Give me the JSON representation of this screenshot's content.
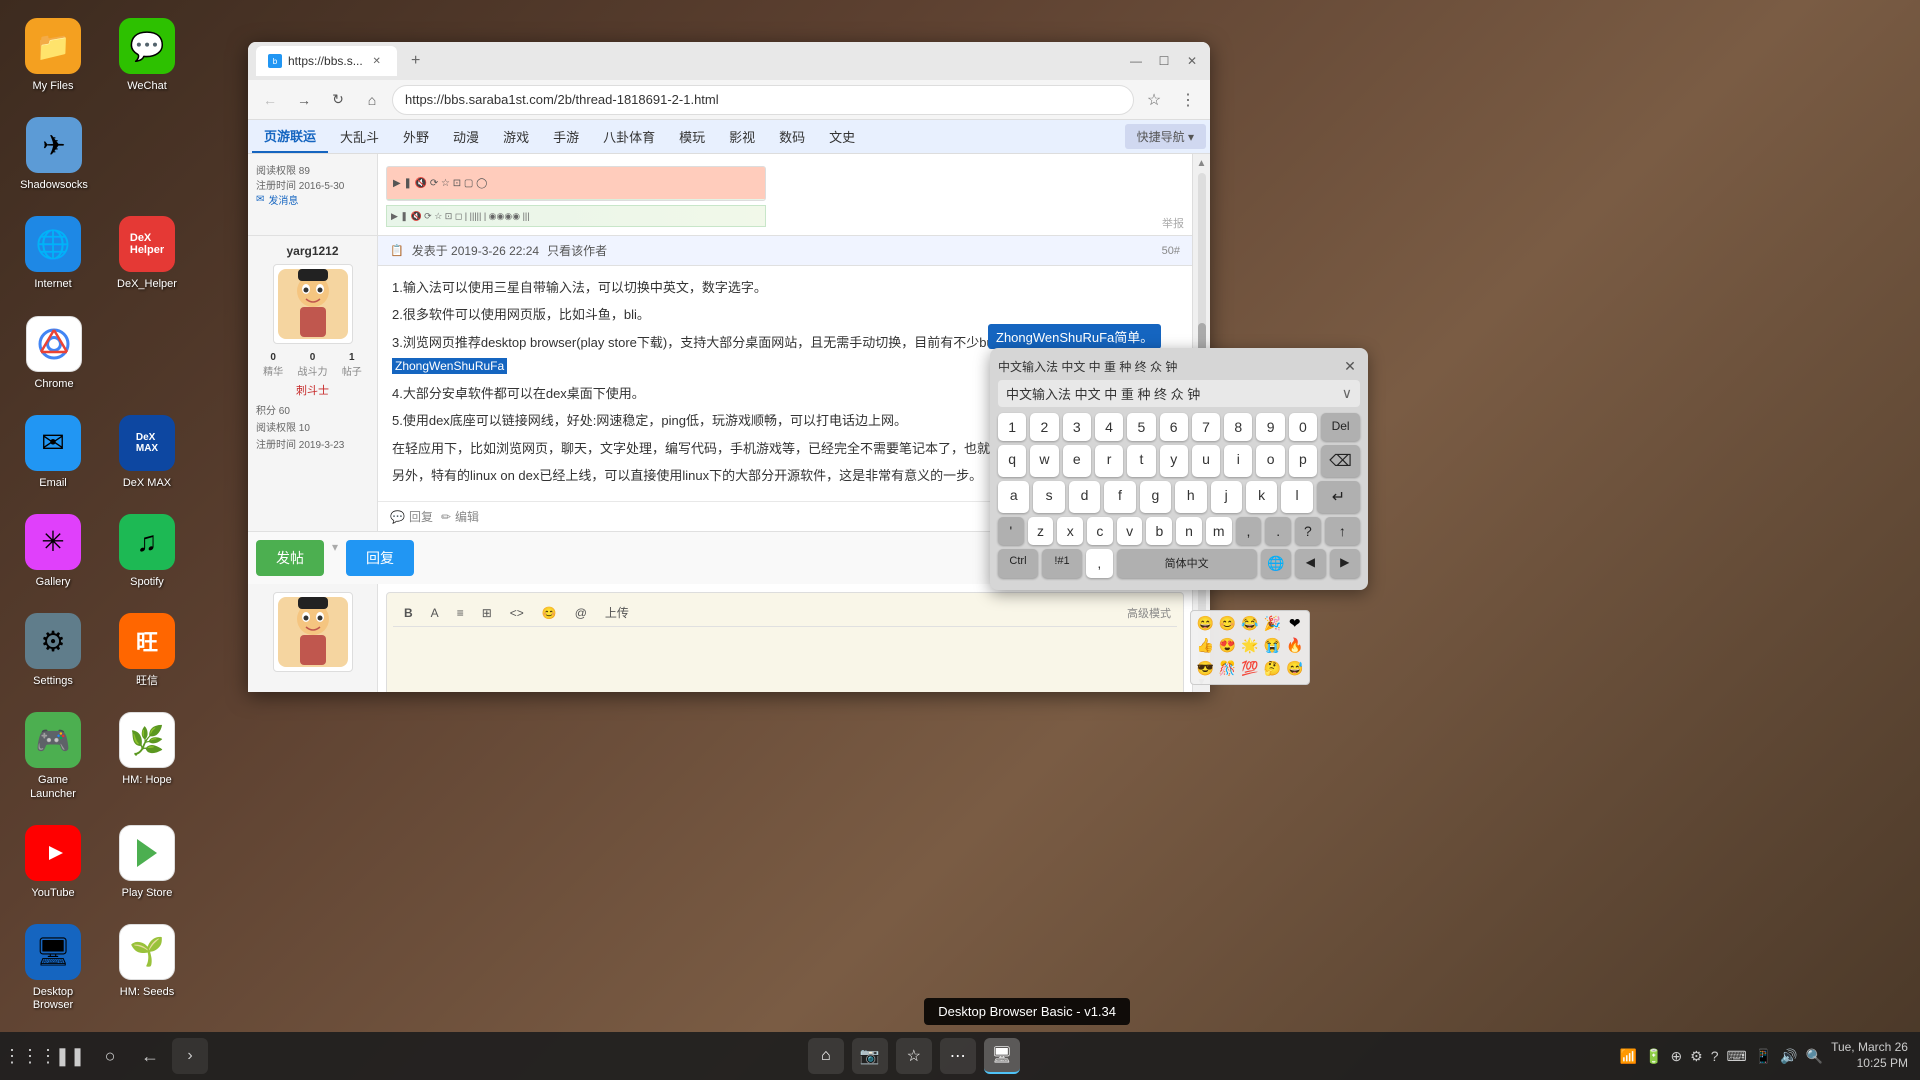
{
  "desktop": {
    "icons": [
      {
        "id": "my-files",
        "label": "My Files",
        "emoji": "📁",
        "color": "#f4a020",
        "row": 0
      },
      {
        "id": "wechat",
        "label": "WeChat",
        "emoji": "💬",
        "color": "#2dc100",
        "row": 0
      },
      {
        "id": "shadowsocks",
        "label": "Shadowsocks",
        "emoji": "✈",
        "color": "#2196f3",
        "row": 0
      },
      {
        "id": "internet",
        "label": "Internet",
        "emoji": "🌐",
        "color": "#1e88e5",
        "row": 1
      },
      {
        "id": "dex-helper",
        "label": "DeX_Helper",
        "emoji": "🔧",
        "color": "#e53935",
        "row": 1
      },
      {
        "id": "chrome",
        "label": "Chrome",
        "emoji": "◎",
        "color": "#fff",
        "row": 1
      },
      {
        "id": "email",
        "label": "Email",
        "emoji": "✉",
        "color": "#2196f3",
        "row": 2
      },
      {
        "id": "dex-max",
        "label": "DeX MAX",
        "emoji": "◼",
        "color": "#0d47a1",
        "row": 2
      },
      {
        "id": "gallery",
        "label": "Gallery",
        "emoji": "✳",
        "color": "#e040fb",
        "row": 3
      },
      {
        "id": "spotify",
        "label": "Spotify",
        "emoji": "♫",
        "color": "#1db954",
        "row": 3
      },
      {
        "id": "settings",
        "label": "Settings",
        "emoji": "⚙",
        "color": "#607d8b",
        "row": 4
      },
      {
        "id": "wangxin",
        "label": "旺信",
        "emoji": "W",
        "color": "#ff6d00",
        "row": 4
      },
      {
        "id": "game-launcher",
        "label": "Game Launcher",
        "emoji": "🎮",
        "color": "#4caf50",
        "row": 5
      },
      {
        "id": "hm-hope",
        "label": "HM: Hope",
        "emoji": "🌿",
        "color": "#fff",
        "row": 5
      },
      {
        "id": "youtube",
        "label": "YouTube",
        "emoji": "▶",
        "color": "#ff0000",
        "row": 6
      },
      {
        "id": "play-store",
        "label": "Play Store",
        "emoji": "▷",
        "color": "#fff",
        "row": 6
      },
      {
        "id": "desktop-browser",
        "label": "Desktop Browser",
        "emoji": "🖥",
        "color": "#1565c0",
        "row": 7
      },
      {
        "id": "hm-seeds",
        "label": "HM: Seeds",
        "emoji": "🌱",
        "color": "#fff",
        "row": 7
      }
    ]
  },
  "browser": {
    "tab_label": "https://bbs.s...",
    "url": "https://bbs.saraba1st.com/2b/thread-1818691-2-1.html",
    "nav_tabs": [
      "页游联运",
      "大乱斗",
      "外野",
      "动漫",
      "游戏",
      "手游",
      "八卦体育",
      "模玩",
      "影视",
      "数码",
      "文史"
    ],
    "active_tab": "页游联运",
    "quick_nav": "快捷导航 ▾"
  },
  "posts": [
    {
      "username": "yarg1212",
      "post_date": "发表于 2019-3-26 22:24",
      "view_author": "只看该作者",
      "post_num": "50#",
      "stats": {
        "精华": "0",
        "战斗力": "0",
        "帖子": "1"
      },
      "rank": "刺斗士",
      "integral": "积分",
      "integral_val": "60",
      "read_perm": "阅读权限",
      "read_perm_val": "10",
      "join_date": "注册时间",
      "join_date_val": "2019-3-23",
      "content": [
        "1.输入法可以使用三星自带输入法，可以切换中英文，数字选字。",
        "2.很多软件可以使用网页版，比如斗鱼，bli。",
        "3.浏览网页推荐desktop browser(play store下载)，支持大部分桌面网站，且无需手动切换，目前有不少bug，但是是已经和",
        "4.大部分安卓软件都可以在dex桌面下使用。",
        "5.使用dex底座可以链接网线，好处:网速稳定，ping低，玩游戏顺畅，可以打电话边上网。",
        "在轻应用下，比如浏览网页，聊天，文字处理，编写代码，手机游戏等，已经完全不需要笔记本了，也就是说，以后只需要...",
        "另外，特有的linux on dex已经上线，可以直接使用linux下的大部分开源软件，这是非常有意义的一步。"
      ]
    }
  ],
  "keyboard": {
    "title": "中文输入法 中文 中 重 种 终 众 钟",
    "close_label": "✕",
    "expand_label": "∨",
    "rows": {
      "numbers": [
        "1",
        "2",
        "3",
        "4",
        "5",
        "6",
        "7",
        "8",
        "9",
        "0",
        "Del"
      ],
      "row1": [
        "q",
        "w",
        "e",
        "r",
        "t",
        "y",
        "u",
        "i",
        "o",
        "p",
        "⌫"
      ],
      "row2": [
        "a",
        "s",
        "d",
        "f",
        "g",
        "h",
        "j",
        "k",
        "l",
        "↵"
      ],
      "row3": [
        "'",
        "z",
        "x",
        "c",
        "v",
        "b",
        "n",
        "m",
        ",",
        ".",
        "/",
        "↑"
      ],
      "bottom": [
        "Ctrl",
        "!#1",
        ",",
        "简体中文",
        "🌐",
        "◀",
        "▶"
      ]
    }
  },
  "tooltip": {
    "text": "ZhongWenShuRuFa简单。"
  },
  "bottom_bar": {
    "left_icons": [
      "⋮⋮⋮",
      "❚❚",
      "○",
      "←"
    ],
    "center_icon": "🖥",
    "right_icons": [
      "🏠",
      "📷",
      "☆",
      "⋯"
    ],
    "time": "Tue, March 26 10:25 PM",
    "right_status": [
      "🔋",
      "📶",
      "🔊",
      "⚙",
      "?",
      "⌨",
      "📱",
      "🕐"
    ]
  },
  "browser_basic_tooltip": "Desktop Browser Basic - v1.34",
  "action_bar": {
    "post_btn": "发帖",
    "reply_btn": "回复"
  },
  "editor": {
    "advanced_mode": "高级模式",
    "toolbar_items": [
      "B",
      "A",
      "≡",
      "±",
      "<>",
      "😊",
      "@",
      "上传"
    ]
  }
}
